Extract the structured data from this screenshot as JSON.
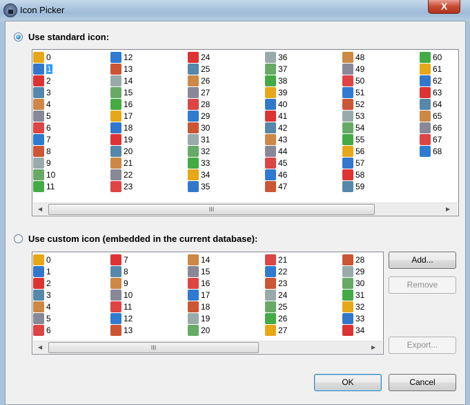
{
  "window": {
    "title": "Icon Picker",
    "close": "X"
  },
  "standard": {
    "label": "Use standard icon:",
    "selected": true,
    "selected_item": "1",
    "items": [
      "0",
      "1",
      "2",
      "3",
      "4",
      "5",
      "6",
      "7",
      "8",
      "9",
      "10",
      "11",
      "12",
      "13",
      "14",
      "15",
      "16",
      "17",
      "18",
      "19",
      "20",
      "21",
      "22",
      "23",
      "24",
      "25",
      "26",
      "27",
      "28",
      "29",
      "30",
      "31",
      "32",
      "33",
      "34",
      "35",
      "36",
      "37",
      "38",
      "39",
      "40",
      "41",
      "42",
      "43",
      "44",
      "45",
      "46",
      "47",
      "48",
      "49",
      "50",
      "51",
      "52",
      "53",
      "54",
      "55",
      "56",
      "57",
      "58",
      "59",
      "60",
      "61",
      "62",
      "63",
      "64",
      "65",
      "66",
      "67",
      "68"
    ],
    "scroll_thumb": "III"
  },
  "custom": {
    "label": "Use custom icon (embedded in the current database):",
    "selected": false,
    "items": [
      "0",
      "1",
      "2",
      "3",
      "4",
      "5",
      "6",
      "7",
      "8",
      "9",
      "10",
      "11",
      "12",
      "13",
      "14",
      "15",
      "16",
      "17",
      "18",
      "19",
      "20",
      "21",
      "22",
      "23",
      "24",
      "25",
      "26",
      "27",
      "28",
      "29",
      "30",
      "31",
      "32",
      "33",
      "34"
    ],
    "scroll_thumb": "III"
  },
  "buttons": {
    "add": "Add...",
    "remove": "Remove",
    "export": "Export...",
    "ok": "OK",
    "cancel": "Cancel"
  },
  "icon_colors": [
    "#e6a817",
    "#2e7bd1",
    "#d33",
    "#9aa",
    "#c84",
    "#4a4",
    "#d44",
    "#37c",
    "#c53",
    "#58a",
    "#6a6",
    "#889"
  ]
}
